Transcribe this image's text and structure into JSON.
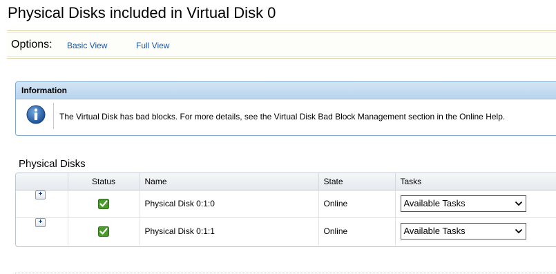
{
  "page": {
    "title": "Physical Disks included in Virtual Disk 0"
  },
  "options": {
    "label": "Options:",
    "links": [
      "Basic View",
      "Full View"
    ]
  },
  "info": {
    "header": "Information",
    "message": "The Virtual Disk has bad blocks. For more details, see the Virtual Disk Bad Block Management section in the Online Help.",
    "icon": "info-icon"
  },
  "section": {
    "title": "Physical Disks"
  },
  "table": {
    "columns": [
      "",
      "Status",
      "Name",
      "State",
      "Tasks"
    ],
    "rows": [
      {
        "expand": "+",
        "status_icon": "green-check-icon",
        "name": "Physical Disk 0:1:0",
        "state": "Online",
        "task": "Available Tasks"
      },
      {
        "expand": "+",
        "status_icon": "green-check-icon",
        "name": "Physical Disk 0:1:1",
        "state": "Online",
        "task": "Available Tasks"
      }
    ]
  },
  "colors": {
    "link": "#1a57a6",
    "info_header": "#b8d4ee",
    "status_ok": "#4a9a2c"
  }
}
